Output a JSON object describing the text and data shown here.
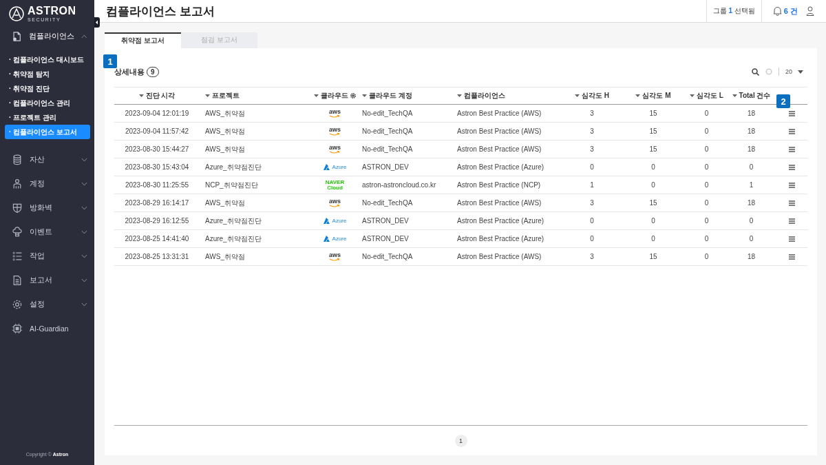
{
  "brand": {
    "name": "ASTRON",
    "tagline": "SECURITY"
  },
  "sidebar": {
    "sections": [
      {
        "label": "컴플라이언스",
        "kind": "group",
        "expanded": true,
        "children": [
          {
            "label": "· 컴플라이언스 대시보드",
            "selected": false
          },
          {
            "label": "· 취약점 탐지",
            "selected": false
          },
          {
            "label": "· 취약점 진단",
            "selected": false
          },
          {
            "label": "· 컴플라이언스 관리",
            "selected": false
          },
          {
            "label": "· 프로젝트 관리",
            "selected": false
          },
          {
            "label": "· 컴플라이언스 보고서",
            "selected": true
          }
        ]
      },
      {
        "label": "자산",
        "kind": "group",
        "expanded": false
      },
      {
        "label": "계정",
        "kind": "group",
        "expanded": false
      },
      {
        "label": "방화벽",
        "kind": "group",
        "expanded": false
      },
      {
        "label": "이벤트",
        "kind": "group",
        "expanded": false
      },
      {
        "label": "작업",
        "kind": "group",
        "expanded": false
      },
      {
        "label": "보고서",
        "kind": "group",
        "expanded": false
      },
      {
        "label": "설정",
        "kind": "group",
        "expanded": false
      },
      {
        "label": "AI-Guardian",
        "kind": "link"
      }
    ],
    "copyright": "Copyright © **Astron**"
  },
  "header": {
    "title": "컴플라이언스 보고서",
    "group_selection": {
      "prefix": "그룹",
      "count": "1",
      "suffix": "선택됨"
    },
    "notifications": {
      "count": "6 건"
    }
  },
  "tabs": [
    {
      "label": "취약점 보고서",
      "selected": true
    },
    {
      "label": "점검 보고서",
      "selected": false
    }
  ],
  "panel": {
    "title": "상세내용",
    "count": "9",
    "page_size": "20",
    "markers": [
      "1",
      "2"
    ],
    "columns": [
      {
        "label": "진단 시각",
        "settings_icon": false
      },
      {
        "label": "프로젝트",
        "settings_icon": false
      },
      {
        "label": "클라우드",
        "settings_icon": true
      },
      {
        "label": "클라우드 계정",
        "settings_icon": false
      },
      {
        "label": "컴플라이언스",
        "settings_icon": false
      },
      {
        "label": "심각도 H",
        "settings_icon": false
      },
      {
        "label": "심각도 M",
        "settings_icon": false
      },
      {
        "label": "심각도 L",
        "settings_icon": false
      },
      {
        "label": "Total 건수",
        "settings_icon": false
      }
    ],
    "rows": [
      {
        "time": "2023-09-04 12:01:19",
        "project": "AWS_취약점",
        "cloud": {
          "kind": "aws",
          "logo": "aws"
        },
        "account": "No-edit_TechQA",
        "compliance": "Astron Best Practice (AWS)",
        "high": "3",
        "medium": "15",
        "low": "0",
        "total": "18"
      },
      {
        "time": "2023-09-04 11:57:42",
        "project": "AWS_취약점",
        "cloud": {
          "kind": "aws",
          "logo": "aws"
        },
        "account": "No-edit_TechQA",
        "compliance": "Astron Best Practice (AWS)",
        "high": "3",
        "medium": "15",
        "low": "0",
        "total": "18"
      },
      {
        "time": "2023-08-30 15:44:27",
        "project": "AWS_취약점",
        "cloud": {
          "kind": "aws",
          "logo": "aws"
        },
        "account": "No-edit_TechQA",
        "compliance": "Astron Best Practice (AWS)",
        "high": "3",
        "medium": "15",
        "low": "0",
        "total": "18"
      },
      {
        "time": "2023-08-30 15:43:04",
        "project": "Azure_취약점진단",
        "cloud": {
          "kind": "azure",
          "logo": "Azure"
        },
        "account": "ASTRON_DEV",
        "compliance": "Astron Best Practice (Azure)",
        "high": "0",
        "medium": "0",
        "low": "0",
        "total": "0"
      },
      {
        "time": "2023-08-30 11:25:55",
        "project": "NCP_취약점진단",
        "cloud": {
          "kind": "naver",
          "logo": "NAVER Cloud"
        },
        "account": "astron-astroncloud.co.kr",
        "compliance": "Astron Best Practice (NCP)",
        "high": "1",
        "medium": "0",
        "low": "0",
        "total": "1"
      },
      {
        "time": "2023-08-29 16:14:17",
        "project": "AWS_취약점",
        "cloud": {
          "kind": "aws",
          "logo": "aws"
        },
        "account": "No-edit_TechQA",
        "compliance": "Astron Best Practice (AWS)",
        "high": "3",
        "medium": "15",
        "low": "0",
        "total": "18"
      },
      {
        "time": "2023-08-29 16:12:55",
        "project": "Azure_취약점진단",
        "cloud": {
          "kind": "azure",
          "logo": "Azure"
        },
        "account": "ASTRON_DEV",
        "compliance": "Astron Best Practice (Azure)",
        "high": "0",
        "medium": "0",
        "low": "0",
        "total": "0"
      },
      {
        "time": "2023-08-25 14:41:40",
        "project": "Azure_취약점진단",
        "cloud": {
          "kind": "azure",
          "logo": "Azure"
        },
        "account": "ASTRON_DEV",
        "compliance": "Astron Best Practice (Azure)",
        "high": "0",
        "medium": "0",
        "low": "0",
        "total": "0"
      },
      {
        "time": "2023-08-25 13:31:31",
        "project": "AWS_취약점",
        "cloud": {
          "kind": "aws",
          "logo": "aws"
        },
        "account": "No-edit_TechQA",
        "compliance": "Astron Best Practice (AWS)",
        "high": "3",
        "medium": "15",
        "low": "0",
        "total": "18"
      }
    ],
    "pagination": [
      {
        "label": "1",
        "selected": true
      }
    ]
  }
}
